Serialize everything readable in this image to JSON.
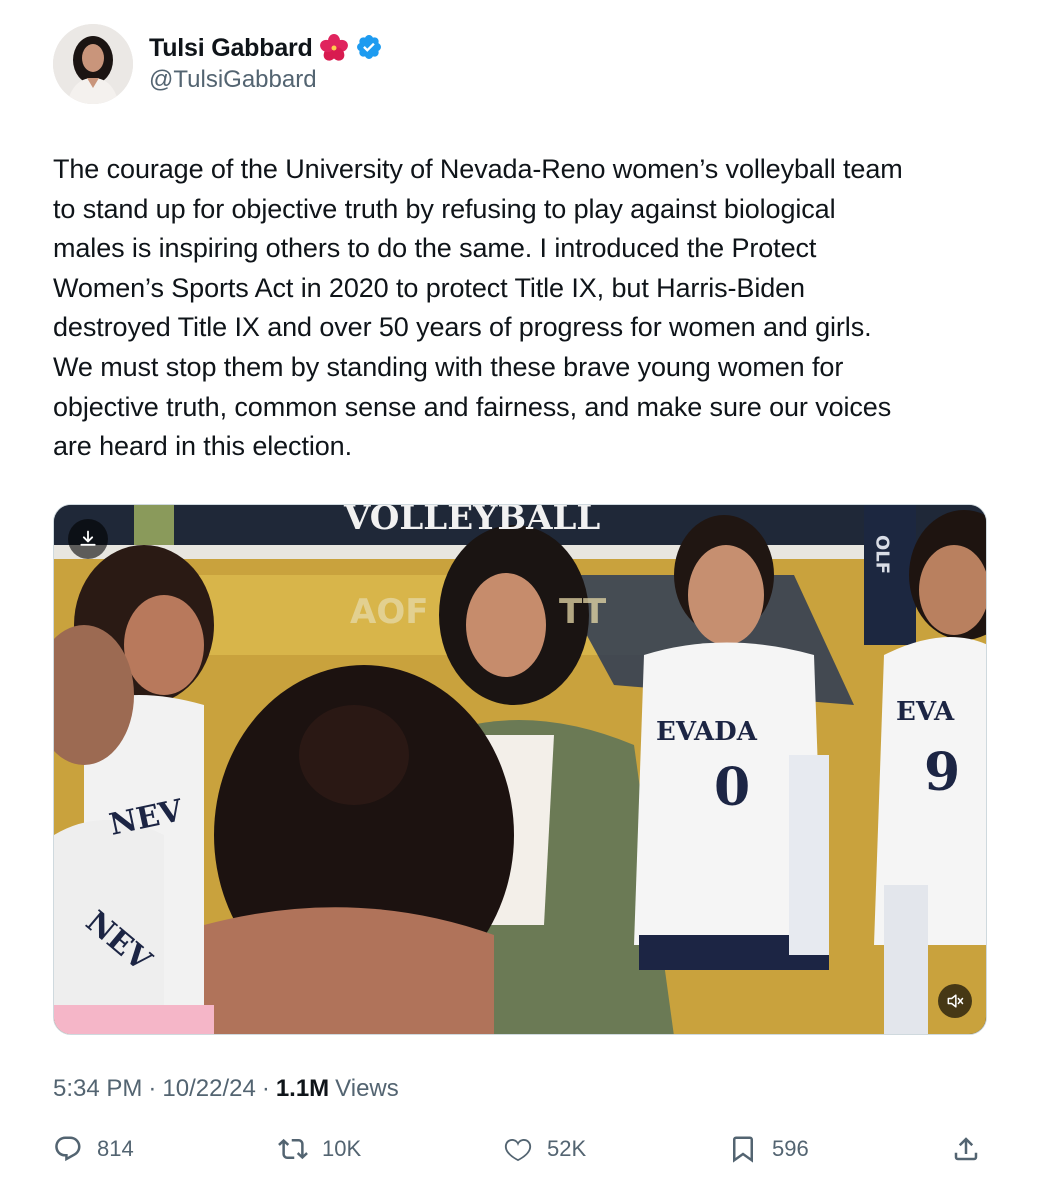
{
  "author": {
    "display_name": "Tulsi Gabbard",
    "handle": "@TulsiGabbard",
    "name_emoji": "hibiscus-icon",
    "verified_icon": "verified-badge-icon",
    "verified_color": "#1d9bf0"
  },
  "tweet": {
    "text": "The courage of the University of Nevada-Reno women’s volleyball team\nto stand up for objective truth by refusing to play against biological\nmales is inspiring others to do the same. I introduced the Protect\nWomen’s Sports Act in 2020 to protect Title IX, but Harris-Biden\ndestroyed Title IX and over 50 years of progress for women and girls.\nWe must stop them by standing with these brave young women for\nobjective truth, common sense and fairness, and make sure our voices\nare heard in this election."
  },
  "media": {
    "type": "video",
    "scene_text_top": "VOLLEYBALL",
    "scene_text_floor": "AOF",
    "scene_text_floor_right": "TT",
    "jersey_text_center": "EVADA",
    "jersey_number_center": "0",
    "jersey_text_right": "EVA",
    "jersey_number_right": "9",
    "jersey_text_left": "NEV",
    "jersey_text_left2": "NEV",
    "banner_text_right": "OLF",
    "download_icon": "download-icon",
    "mute_icon": "muted-speaker-icon"
  },
  "meta": {
    "time": "5:34 PM",
    "separator": "·",
    "date": "10/22/24",
    "views_count": "1.1M",
    "views_label": "Views"
  },
  "actions": {
    "replies": {
      "icon": "reply-icon",
      "count": "814"
    },
    "reposts": {
      "icon": "repost-icon",
      "count": "10K"
    },
    "likes": {
      "icon": "heart-icon",
      "count": "52K"
    },
    "bookmarks": {
      "icon": "bookmark-icon",
      "count": "596"
    },
    "share": {
      "icon": "share-icon"
    }
  },
  "colors": {
    "text_primary": "#0f1419",
    "text_secondary": "#536471",
    "accent": "#1d9bf0"
  }
}
